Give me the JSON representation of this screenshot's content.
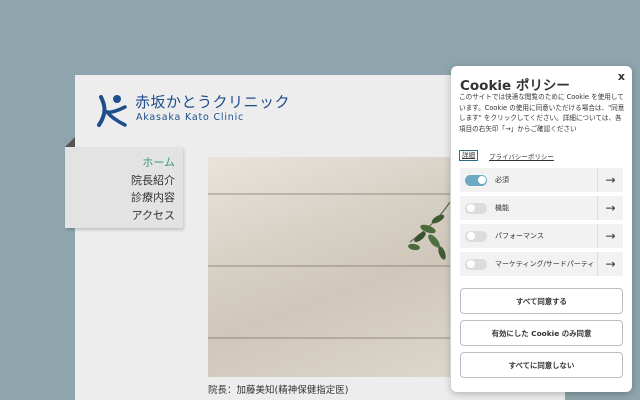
{
  "site": {
    "logo_jp": "赤坂かとうクリニック",
    "logo_en": "Akasaka Kato Clinic",
    "brand_color": "#1f4e8c",
    "accent_color": "#3c9a7a"
  },
  "nav": {
    "items": [
      {
        "label": "ホーム",
        "active": true
      },
      {
        "label": "院長紹介",
        "active": false
      },
      {
        "label": "診療内容",
        "active": false
      },
      {
        "label": "アクセス",
        "active": false
      }
    ]
  },
  "main": {
    "caption": "院長：加藤美知(精神保健指定医)"
  },
  "cookie": {
    "title": "Cookie ポリシー",
    "close": "x",
    "description": "このサイトでは快適な閲覧のために Cookie を使用しています。Cookie の使用に同意いただける場合は、\"同意します\" をクリックしてください。詳細については、各項目の右矢印「→」からご確認ください",
    "details_link": "詳細",
    "privacy_link": "プライバシーポリシー",
    "categories": [
      {
        "label": "必須",
        "enabled": true
      },
      {
        "label": "機能",
        "enabled": false
      },
      {
        "label": "パフォーマンス",
        "enabled": false
      },
      {
        "label": "マーケティング/サードパーティ",
        "enabled": false
      }
    ],
    "arrow": "→",
    "accept_all": "すべて同意する",
    "accept_selected": "有効にした Cookie のみ同意",
    "reject_all": "すべてに同意しない",
    "toggle_on_color": "#6da9c3"
  }
}
